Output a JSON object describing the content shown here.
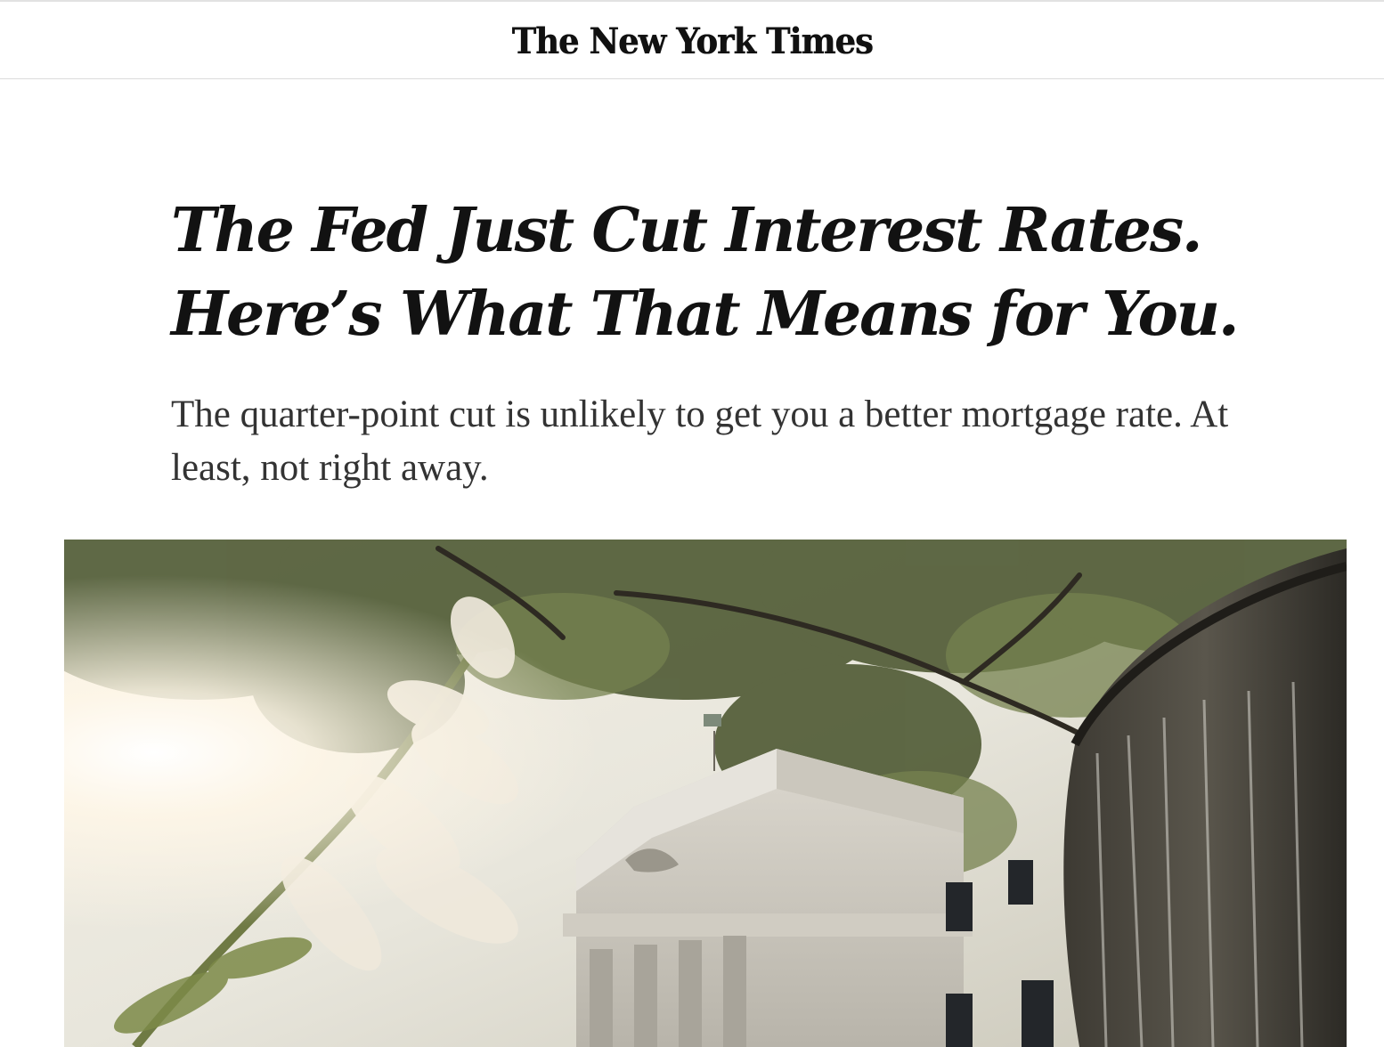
{
  "masthead": {
    "logo_text": "The New York Times"
  },
  "article": {
    "headline_line1": "The Fed Just Cut Interest Rates.",
    "headline_line2": "Here’s What That Means for You.",
    "summary": "The quarter-point cut is unlikely to get you a better mortgage rate. At least, not right away."
  },
  "colors": {
    "text": "#121212",
    "summary_text": "#333333",
    "rule": "#dcdcdc"
  }
}
